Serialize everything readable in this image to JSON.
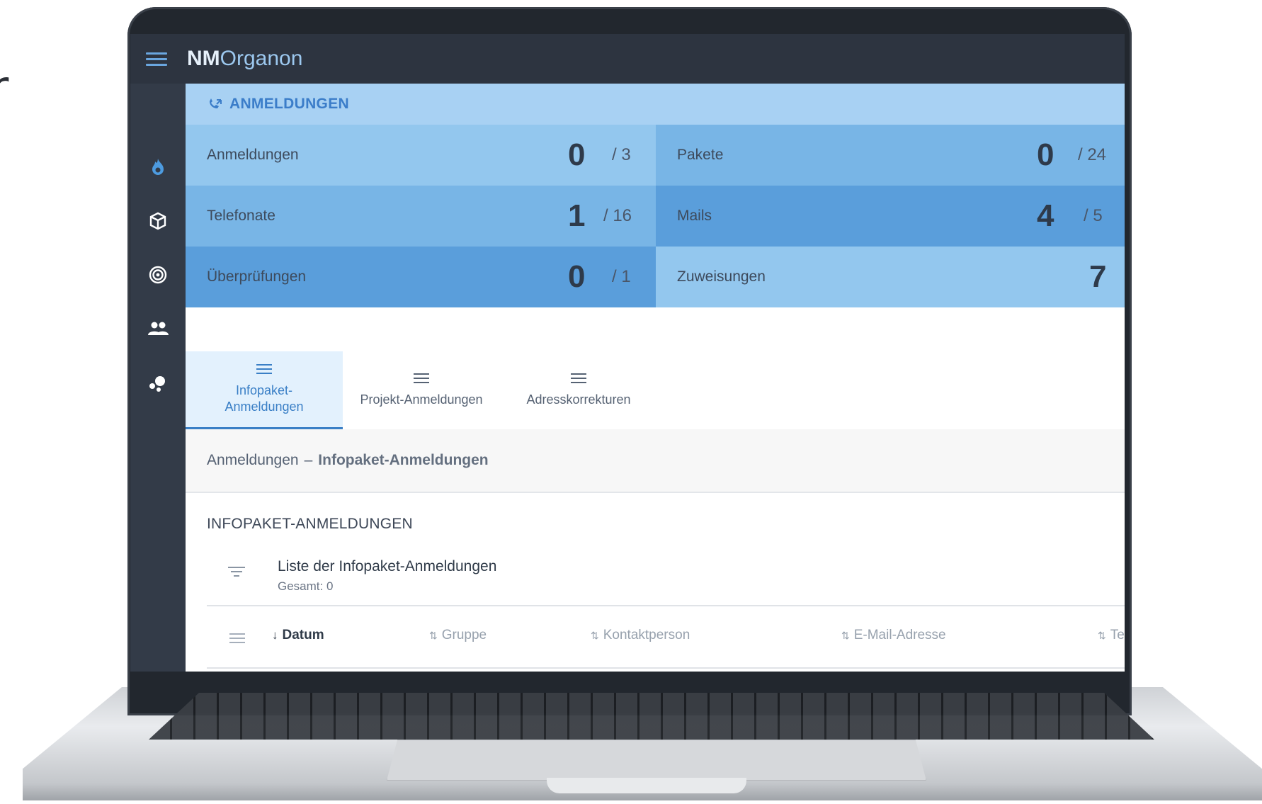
{
  "app": {
    "brand_bold": "NM",
    "brand_rest": "Organon"
  },
  "colors": {
    "topbar": "#2d3440",
    "sidebar": "#333b48",
    "accent": "#3b7dc9",
    "tile_light": "#93c7ee",
    "tile_mid": "#78b5e6",
    "tile_dark": "#5a9edb"
  },
  "sidebar": {
    "items": [
      {
        "icon": "flame-icon"
      },
      {
        "icon": "package-icon"
      },
      {
        "icon": "target-icon"
      },
      {
        "icon": "users-icon"
      },
      {
        "icon": "bubbles-icon"
      }
    ]
  },
  "section": {
    "title": "ANMELDUNGEN",
    "icon": "phone-icon"
  },
  "stats": [
    {
      "label": "Anmeldungen",
      "count": "0",
      "total": "/ 3"
    },
    {
      "label": "Pakete",
      "count": "0",
      "total": "/ 24"
    },
    {
      "label": "Telefonate",
      "count": "1",
      "total": "/ 16"
    },
    {
      "label": "Mails",
      "count": "4",
      "total": "/ 5"
    },
    {
      "label": "Überprüfungen",
      "count": "0",
      "total": "/ 1"
    },
    {
      "label": "Zuweisungen",
      "count": "7",
      "total": ""
    }
  ],
  "tabs": [
    {
      "label": "Infopaket-\nAnmeldungen",
      "active": true
    },
    {
      "label": "Projekt-Anmeldungen",
      "active": false
    },
    {
      "label": "Adresskorrekturen",
      "active": false
    }
  ],
  "breadcrumb": {
    "parent": "Anmeldungen",
    "separator": "–",
    "current": "Infopaket-Anmeldungen"
  },
  "panel": {
    "title": "INFOPAKET-ANMELDUNGEN",
    "list_title": "Liste der Infopaket-Anmeldungen",
    "list_subtitle": "Gesamt: 0"
  },
  "table": {
    "columns": [
      {
        "label": "Datum",
        "sort": "desc"
      },
      {
        "label": "Gruppe",
        "sort": "none"
      },
      {
        "label": "Kontaktperson",
        "sort": "none"
      },
      {
        "label": "E-Mail-Adresse",
        "sort": "none"
      },
      {
        "label": "Te",
        "sort": "none"
      }
    ]
  }
}
